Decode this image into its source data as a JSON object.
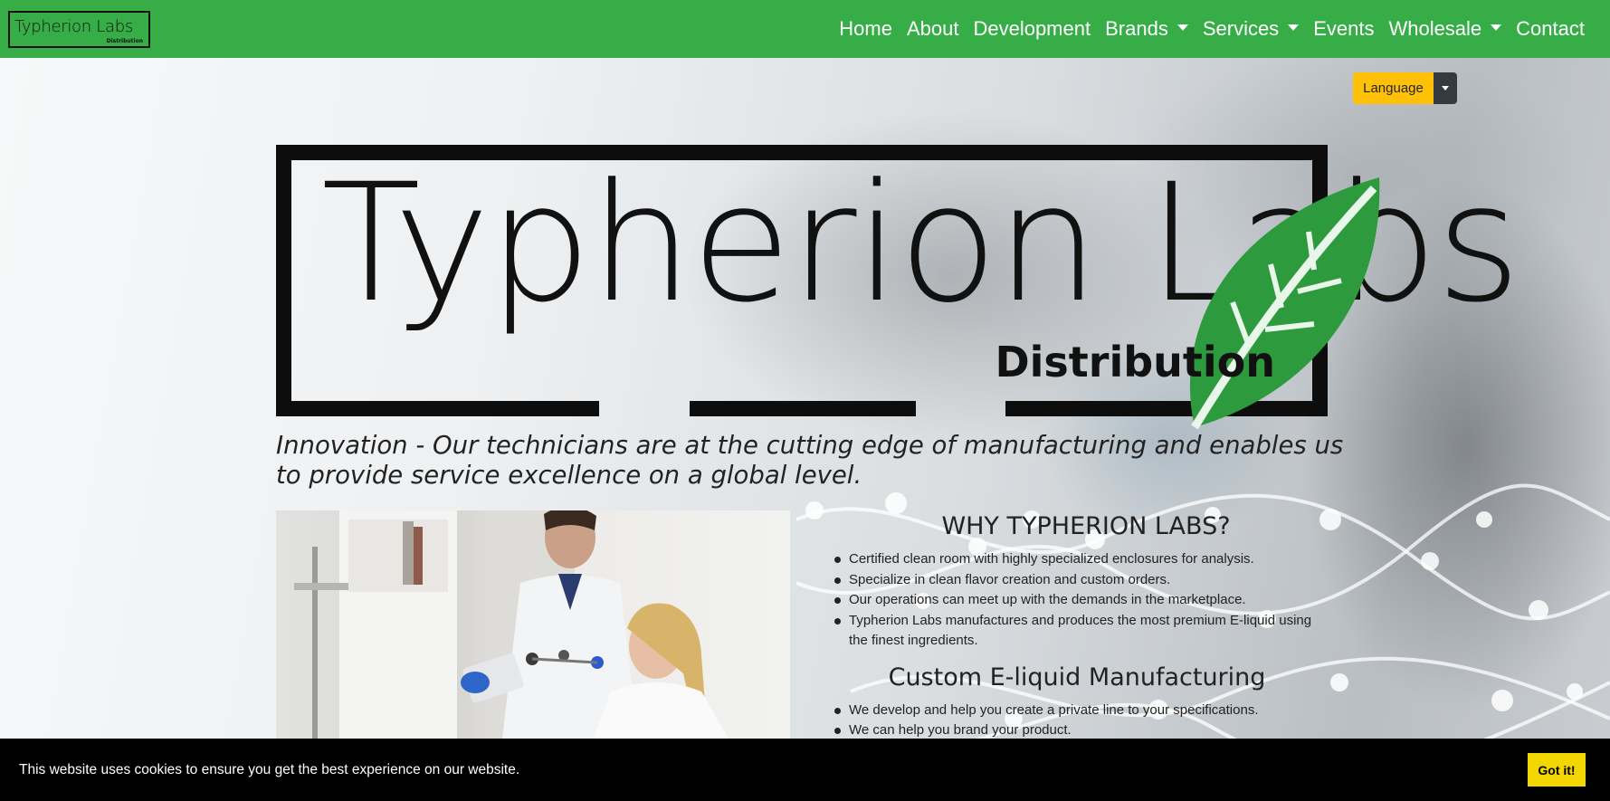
{
  "navbar": {
    "brand_text": "Typherion Labs",
    "brand_sub": "Distribution",
    "links": [
      {
        "label": "Home",
        "dropdown": false
      },
      {
        "label": "About",
        "dropdown": false
      },
      {
        "label": "Development",
        "dropdown": false
      },
      {
        "label": "Brands",
        "dropdown": true
      },
      {
        "label": "Services",
        "dropdown": true
      },
      {
        "label": "Events",
        "dropdown": false
      },
      {
        "label": "Wholesale",
        "dropdown": true
      },
      {
        "label": "Contact",
        "dropdown": false
      }
    ],
    "bg_color": "#36ad47"
  },
  "language": {
    "label": "Language"
  },
  "hero": {
    "logo_title": "Typherion Labs",
    "logo_sub": "Distribution",
    "tagline": "Innovation - Our technicians are at the cutting edge of manufacturing and enables us to provide service excellence on a global level."
  },
  "why": {
    "heading": "WHY TYPHERION LABS?",
    "items": [
      "Certified clean room with highly specialized enclosures for analysis.",
      "Specialize in clean flavor creation and custom orders.",
      "Our operations can meet up with the demands in the marketplace.",
      "Typherion Labs manufactures and produces the most premium E-liquid using the finest ingredients."
    ],
    "custom_heading": "Custom E-liquid Manufacturing",
    "custom_items": [
      "We develop and help you create a private line to your specifications.",
      "We can help you brand your product."
    ]
  },
  "cookie": {
    "message": "This website uses cookies to ensure you get the best experience on our website.",
    "button": "Got it!",
    "button_color": "#f1d600"
  }
}
